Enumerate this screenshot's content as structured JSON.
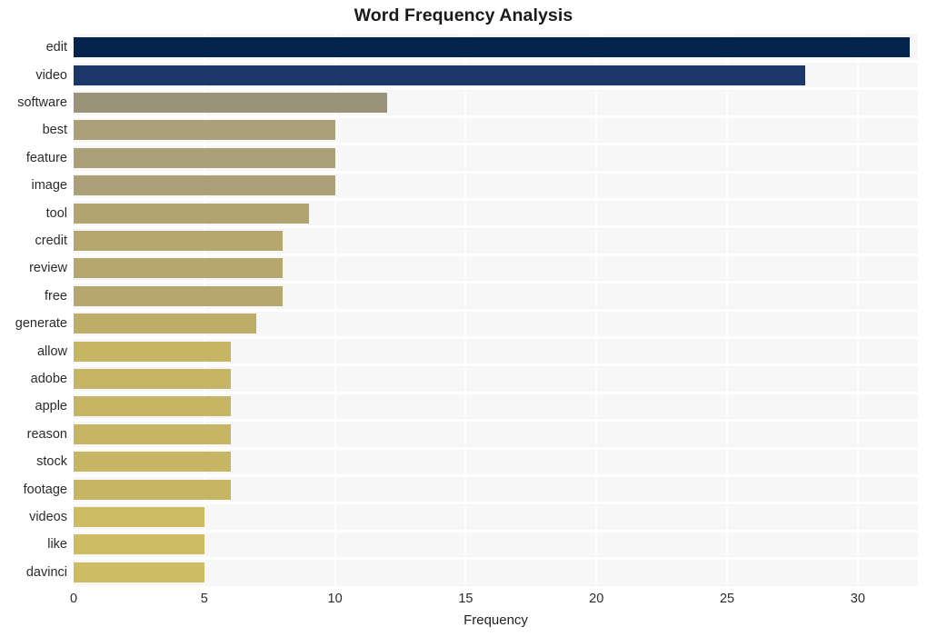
{
  "chart_data": {
    "type": "bar",
    "orientation": "horizontal",
    "title": "Word Frequency Analysis",
    "xlabel": "Frequency",
    "ylabel": "",
    "xlim": [
      0,
      32.3
    ],
    "ylim": [
      0,
      20
    ],
    "grid": true,
    "legend": false,
    "xticks": [
      0,
      5,
      10,
      15,
      20,
      25,
      30
    ],
    "xtick_labels": [
      "0",
      "5",
      "10",
      "15",
      "20",
      "25",
      "30"
    ],
    "categories": [
      "edit",
      "video",
      "software",
      "best",
      "feature",
      "image",
      "tool",
      "credit",
      "review",
      "free",
      "generate",
      "allow",
      "adobe",
      "apple",
      "reason",
      "stock",
      "footage",
      "videos",
      "like",
      "davinci"
    ],
    "values": [
      32,
      28,
      12,
      10,
      10,
      10,
      9,
      8,
      8,
      8,
      7,
      6,
      6,
      6,
      6,
      6,
      6,
      5,
      5,
      5
    ],
    "bar_colors": [
      "#04234d",
      "#1c3769",
      "#9a9279",
      "#aba07a",
      "#aba07a",
      "#aba07a",
      "#b1a471",
      "#b5a76d",
      "#b5a76d",
      "#b5a76d",
      "#bdad69",
      "#c5b564",
      "#c5b564",
      "#c5b564",
      "#c5b564",
      "#c5b564",
      "#c5b564",
      "#cdbc61",
      "#cdbc61",
      "#cdbc61"
    ],
    "plot_background": "#f7f7f8",
    "gridline_color": "#ffffff"
  }
}
